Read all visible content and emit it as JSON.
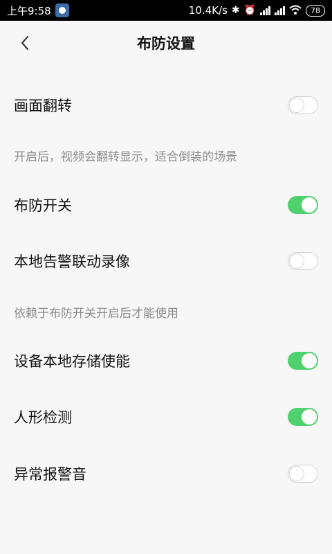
{
  "status_bar": {
    "time": "上午9:58",
    "network_speed": "10.4K/s",
    "battery": "78",
    "icons": [
      "bluetooth-icon",
      "alarm-icon",
      "signal-icon",
      "signal-icon",
      "wifi-icon",
      "battery-icon"
    ]
  },
  "header": {
    "title": "布防设置",
    "back_icon": "chevron-left-icon"
  },
  "settings": [
    {
      "label": "画面翻转",
      "on": false
    },
    {
      "label": "布防开关",
      "on": true
    },
    {
      "label": "本地告警联动录像",
      "on": false
    },
    {
      "label": "设备本地存储使能",
      "on": true
    },
    {
      "label": "人形检测",
      "on": true
    },
    {
      "label": "异常报警音",
      "on": false
    }
  ],
  "hints": {
    "flip": "开启后，视频会翻转显示，适合倒装的场景",
    "local_alarm": "依赖于布防开关开启后才能使用"
  },
  "colors": {
    "toggle_on": "#4fd16e",
    "background": "#f7f7f7",
    "hint_text": "#8c8c8c"
  }
}
